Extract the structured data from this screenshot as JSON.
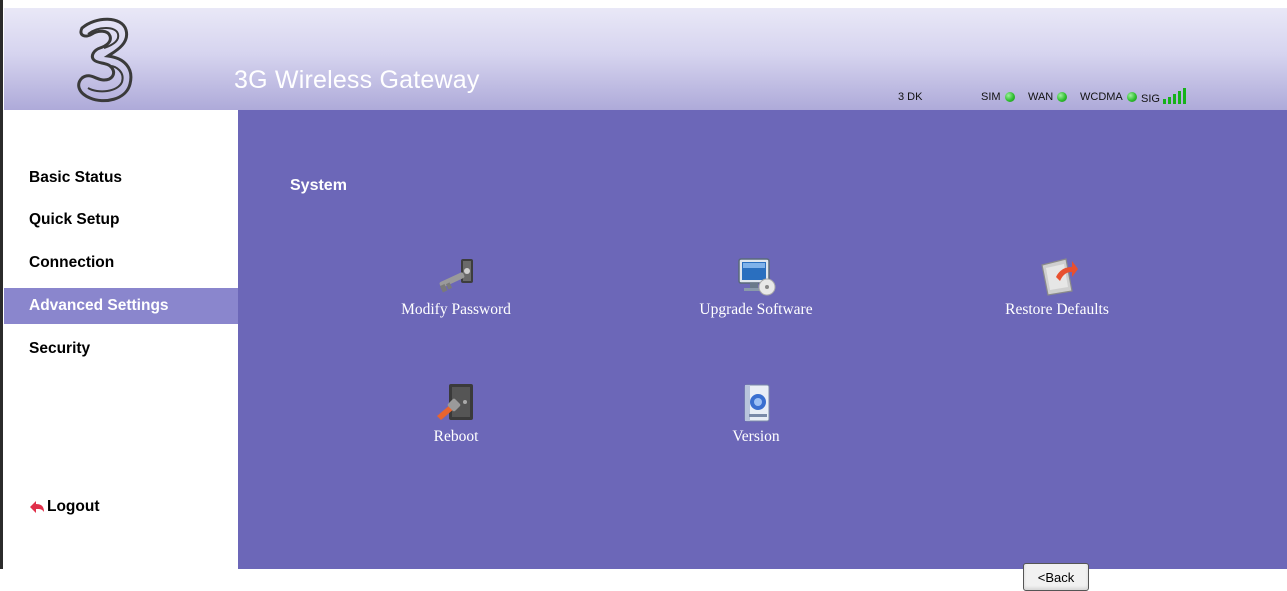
{
  "header": {
    "app_title": "3G Wireless Gateway",
    "operator": "3 DK",
    "indicators": [
      {
        "label": "SIM",
        "state": "ok"
      },
      {
        "label": "WAN",
        "state": "ok"
      },
      {
        "label": "WCDMA",
        "state": "ok"
      }
    ],
    "signal": {
      "label": "SIG",
      "bars": 5,
      "max_bars": 5
    }
  },
  "sidebar": {
    "items": [
      {
        "label": "Basic Status"
      },
      {
        "label": "Quick Setup"
      },
      {
        "label": "Connection"
      },
      {
        "label": "Advanced Settings",
        "active": true
      },
      {
        "label": "Security"
      }
    ],
    "logout_label": "Logout"
  },
  "main": {
    "section_title": "System",
    "tiles": [
      {
        "label": "Modify Password",
        "icon": "key-icon"
      },
      {
        "label": "Upgrade Software",
        "icon": "computer-cd-icon"
      },
      {
        "label": "Restore Defaults",
        "icon": "restore-arrow-icon"
      },
      {
        "label": "Reboot",
        "icon": "reboot-door-icon"
      },
      {
        "label": "Version",
        "icon": "version-book-icon"
      }
    ],
    "back_label": "<Back"
  },
  "colors": {
    "main_bg": "#6c67b8",
    "active_nav_bg": "#8a86cd",
    "led_green": "#2fbf2f",
    "signal_green": "#16b21a"
  }
}
